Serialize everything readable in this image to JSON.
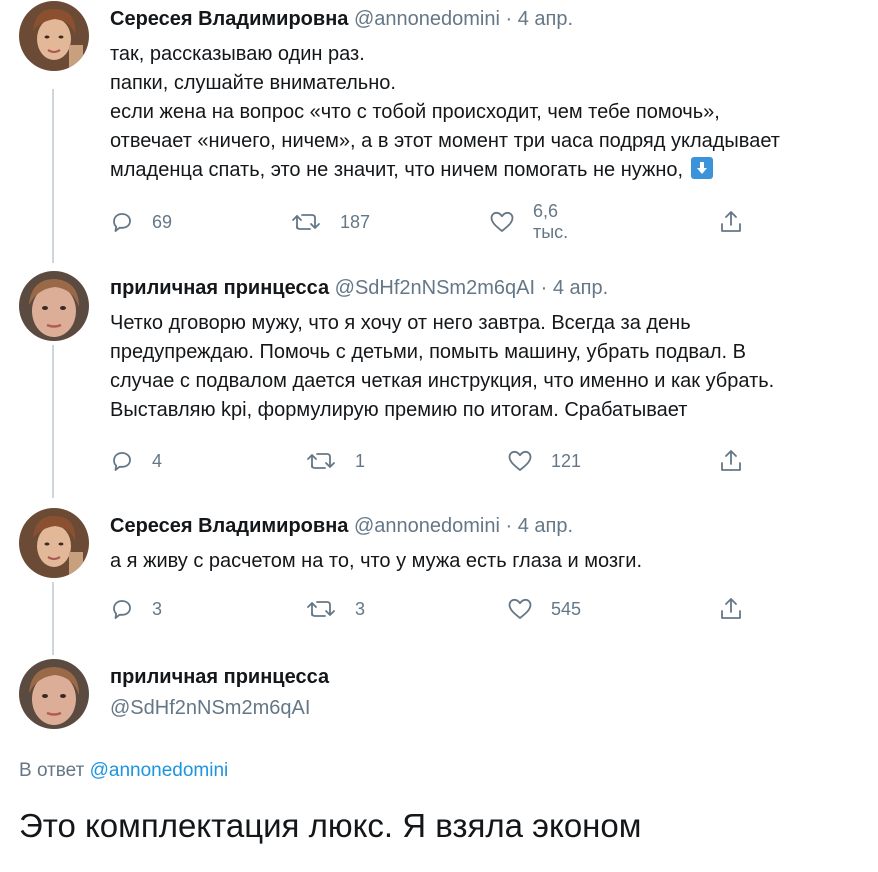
{
  "tweets": [
    {
      "name": "Сересея Владимировна",
      "handle": "@annonedomini",
      "sep": "·",
      "date": "4 апр.",
      "lines": [
        "так, рассказываю один раз.",
        "папки, слушайте внимательно.",
        "если жена на вопрос «что с тобой происходит, чем тебе помочь»,",
        "отвечает «ничего, ничем», а в этот момент три часа подряд укладывает",
        "младенца спать, это не значит, что ничем помогать не нужно,"
      ],
      "emoji": "down-arrow-emoji",
      "replies": "69",
      "retweets": "187",
      "likes": "6,6 тыс."
    },
    {
      "name": "приличная принцесса",
      "handle": "@SdHf2nNSm2m6qAI",
      "sep": "·",
      "date": "4 апр.",
      "lines": [
        "Четко дговорю мужу, что я хочу от него завтра. Всегда за день",
        "предупреждаю. Помочь с детьми, помыть машину, убрать подвал. В",
        "случае с подвалом дается четкая инструкция, что именно и как убрать.",
        "Выставляю kpi, формулирую премию по итогам. Срабатывает"
      ],
      "replies": "4",
      "retweets": "1",
      "likes": "121"
    },
    {
      "name": "Сересея Владимировна",
      "handle": "@annonedomini",
      "sep": "·",
      "date": "4 апр.",
      "lines": [
        "а я живу с расчетом на то, что у мужа есть глаза и мозги."
      ],
      "replies": "3",
      "retweets": "3",
      "likes": "545"
    }
  ],
  "main_tweet": {
    "name": "приличная принцесса",
    "handle": "@SdHf2nNSm2m6qAI",
    "reply_prefix": "В ответ",
    "reply_mention": "@annonedomini",
    "text": "Это комплектация люкс. Я взяла эконом"
  },
  "colors": {
    "text": "#14171a",
    "secondary": "#657786",
    "link": "#1b95e0",
    "thread_line": "#ccd6dd"
  },
  "icons": [
    "reply-icon",
    "retweet-icon",
    "like-icon",
    "share-icon",
    "down-arrow-emoji"
  ]
}
